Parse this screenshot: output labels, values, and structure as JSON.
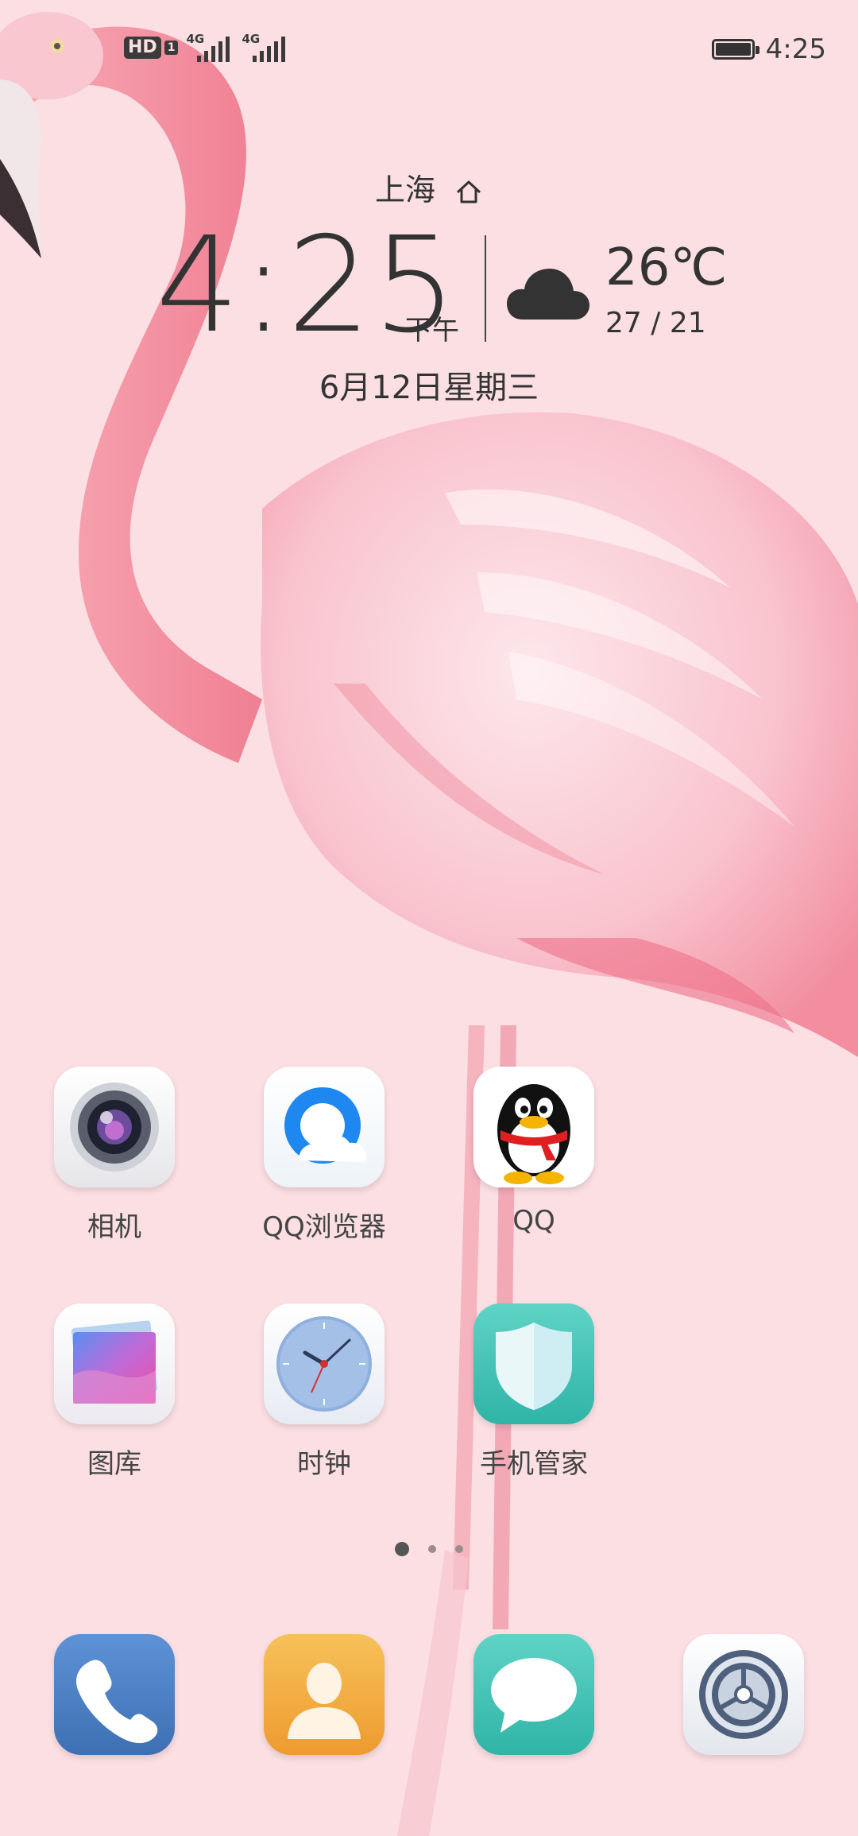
{
  "status_bar": {
    "hd_label": "HD",
    "sim_label": "1",
    "network_1": "4G",
    "network_2": "4G",
    "time": "4:25",
    "battery_level": 1.0
  },
  "clock_widget": {
    "city": "上海",
    "time": "4:25",
    "ampm": "下午",
    "temperature": "26℃",
    "temp_range": "27 / 21",
    "weather_icon": "cloud-icon",
    "date": "6月12日星期三"
  },
  "apps": [
    {
      "label": "相机",
      "icon": "camera-icon"
    },
    {
      "label": "QQ浏览器",
      "icon": "qq-browser-icon"
    },
    {
      "label": "QQ",
      "icon": "qq-penguin-icon"
    },
    {
      "label": "图库",
      "icon": "gallery-icon"
    },
    {
      "label": "时钟",
      "icon": "clock-app-icon"
    },
    {
      "label": "手机管家",
      "icon": "phone-manager-icon"
    }
  ],
  "page_indicator": {
    "pages": 3,
    "active": 1
  },
  "dock": [
    {
      "icon": "phone-icon"
    },
    {
      "icon": "contacts-icon"
    },
    {
      "icon": "messages-icon"
    },
    {
      "icon": "settings-icon"
    }
  ],
  "colors": {
    "background": "#fbdfe3",
    "flamingo": "#f48fa0"
  }
}
